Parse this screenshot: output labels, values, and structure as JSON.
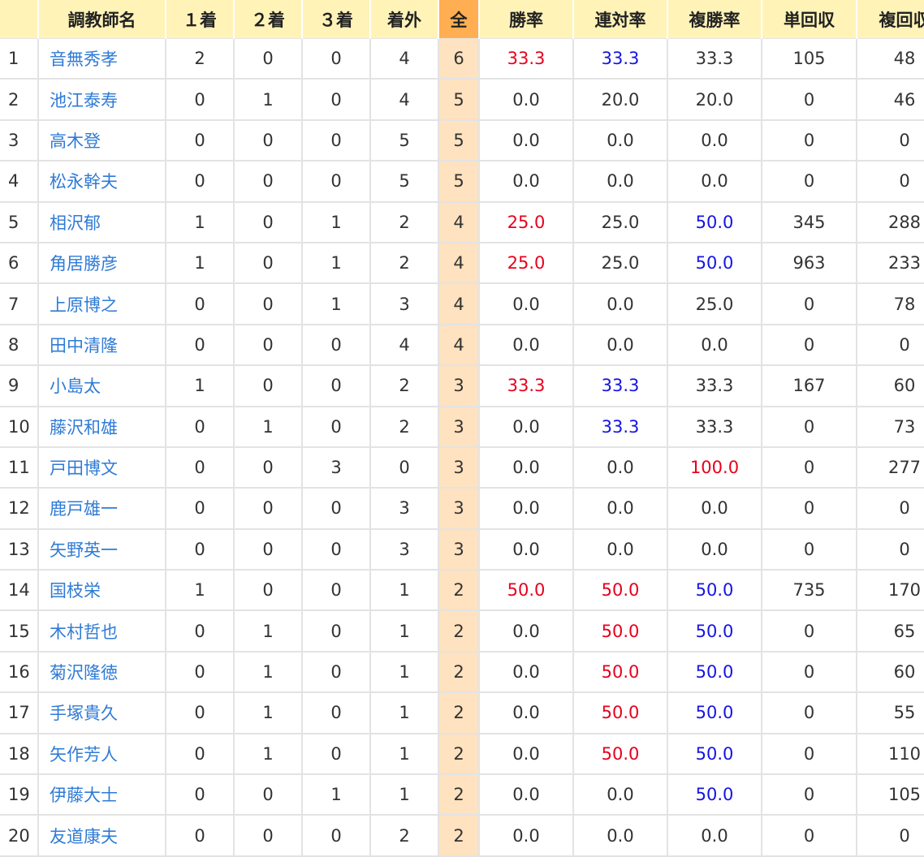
{
  "headers": {
    "rank": "",
    "name": "調教師名",
    "first": "１着",
    "second": "２着",
    "third": "３着",
    "out": "着外",
    "all": "全",
    "win_rate": "勝率",
    "place_rate": "連対率",
    "show_rate": "複勝率",
    "win_return": "単回収",
    "show_return": "複回収"
  },
  "colors": {
    "red": "#e8001c",
    "blue": "#1414e6",
    "link": "#2f7bd6",
    "header_bg": "#fff3b8",
    "all_header_bg": "#ffae52",
    "all_cell_bg": "#ffe2bf"
  },
  "rows": [
    {
      "rank": "1",
      "name": "音無秀孝",
      "first": "2",
      "second": "0",
      "third": "0",
      "out": "4",
      "all": "6",
      "win_rate": "33.3",
      "place_rate": "33.3",
      "show_rate": "33.3",
      "win_return": "105",
      "show_return": "48",
      "win_rate_color": "red",
      "place_rate_color": "blue",
      "show_rate_color": ""
    },
    {
      "rank": "2",
      "name": "池江泰寿",
      "first": "0",
      "second": "1",
      "third": "0",
      "out": "4",
      "all": "5",
      "win_rate": "0.0",
      "place_rate": "20.0",
      "show_rate": "20.0",
      "win_return": "0",
      "show_return": "46",
      "win_rate_color": "",
      "place_rate_color": "",
      "show_rate_color": ""
    },
    {
      "rank": "3",
      "name": "高木登",
      "first": "0",
      "second": "0",
      "third": "0",
      "out": "5",
      "all": "5",
      "win_rate": "0.0",
      "place_rate": "0.0",
      "show_rate": "0.0",
      "win_return": "0",
      "show_return": "0",
      "win_rate_color": "",
      "place_rate_color": "",
      "show_rate_color": ""
    },
    {
      "rank": "4",
      "name": "松永幹夫",
      "first": "0",
      "second": "0",
      "third": "0",
      "out": "5",
      "all": "5",
      "win_rate": "0.0",
      "place_rate": "0.0",
      "show_rate": "0.0",
      "win_return": "0",
      "show_return": "0",
      "win_rate_color": "",
      "place_rate_color": "",
      "show_rate_color": ""
    },
    {
      "rank": "5",
      "name": "相沢郁",
      "first": "1",
      "second": "0",
      "third": "1",
      "out": "2",
      "all": "4",
      "win_rate": "25.0",
      "place_rate": "25.0",
      "show_rate": "50.0",
      "win_return": "345",
      "show_return": "288",
      "win_rate_color": "red",
      "place_rate_color": "",
      "show_rate_color": "blue"
    },
    {
      "rank": "6",
      "name": "角居勝彦",
      "first": "1",
      "second": "0",
      "third": "1",
      "out": "2",
      "all": "4",
      "win_rate": "25.0",
      "place_rate": "25.0",
      "show_rate": "50.0",
      "win_return": "963",
      "show_return": "233",
      "win_rate_color": "red",
      "place_rate_color": "",
      "show_rate_color": "blue"
    },
    {
      "rank": "7",
      "name": "上原博之",
      "first": "0",
      "second": "0",
      "third": "1",
      "out": "3",
      "all": "4",
      "win_rate": "0.0",
      "place_rate": "0.0",
      "show_rate": "25.0",
      "win_return": "0",
      "show_return": "78",
      "win_rate_color": "",
      "place_rate_color": "",
      "show_rate_color": ""
    },
    {
      "rank": "8",
      "name": "田中清隆",
      "first": "0",
      "second": "0",
      "third": "0",
      "out": "4",
      "all": "4",
      "win_rate": "0.0",
      "place_rate": "0.0",
      "show_rate": "0.0",
      "win_return": "0",
      "show_return": "0",
      "win_rate_color": "",
      "place_rate_color": "",
      "show_rate_color": ""
    },
    {
      "rank": "9",
      "name": "小島太",
      "first": "1",
      "second": "0",
      "third": "0",
      "out": "2",
      "all": "3",
      "win_rate": "33.3",
      "place_rate": "33.3",
      "show_rate": "33.3",
      "win_return": "167",
      "show_return": "60",
      "win_rate_color": "red",
      "place_rate_color": "blue",
      "show_rate_color": ""
    },
    {
      "rank": "10",
      "name": "藤沢和雄",
      "first": "0",
      "second": "1",
      "third": "0",
      "out": "2",
      "all": "3",
      "win_rate": "0.0",
      "place_rate": "33.3",
      "show_rate": "33.3",
      "win_return": "0",
      "show_return": "73",
      "win_rate_color": "",
      "place_rate_color": "blue",
      "show_rate_color": ""
    },
    {
      "rank": "11",
      "name": "戸田博文",
      "first": "0",
      "second": "0",
      "third": "3",
      "out": "0",
      "all": "3",
      "win_rate": "0.0",
      "place_rate": "0.0",
      "show_rate": "100.0",
      "win_return": "0",
      "show_return": "277",
      "win_rate_color": "",
      "place_rate_color": "",
      "show_rate_color": "red"
    },
    {
      "rank": "12",
      "name": "鹿戸雄一",
      "first": "0",
      "second": "0",
      "third": "0",
      "out": "3",
      "all": "3",
      "win_rate": "0.0",
      "place_rate": "0.0",
      "show_rate": "0.0",
      "win_return": "0",
      "show_return": "0",
      "win_rate_color": "",
      "place_rate_color": "",
      "show_rate_color": ""
    },
    {
      "rank": "13",
      "name": "矢野英一",
      "first": "0",
      "second": "0",
      "third": "0",
      "out": "3",
      "all": "3",
      "win_rate": "0.0",
      "place_rate": "0.0",
      "show_rate": "0.0",
      "win_return": "0",
      "show_return": "0",
      "win_rate_color": "",
      "place_rate_color": "",
      "show_rate_color": ""
    },
    {
      "rank": "14",
      "name": "国枝栄",
      "first": "1",
      "second": "0",
      "third": "0",
      "out": "1",
      "all": "2",
      "win_rate": "50.0",
      "place_rate": "50.0",
      "show_rate": "50.0",
      "win_return": "735",
      "show_return": "170",
      "win_rate_color": "red",
      "place_rate_color": "red",
      "show_rate_color": "blue"
    },
    {
      "rank": "15",
      "name": "木村哲也",
      "first": "0",
      "second": "1",
      "third": "0",
      "out": "1",
      "all": "2",
      "win_rate": "0.0",
      "place_rate": "50.0",
      "show_rate": "50.0",
      "win_return": "0",
      "show_return": "65",
      "win_rate_color": "",
      "place_rate_color": "red",
      "show_rate_color": "blue"
    },
    {
      "rank": "16",
      "name": "菊沢隆徳",
      "first": "0",
      "second": "1",
      "third": "0",
      "out": "1",
      "all": "2",
      "win_rate": "0.0",
      "place_rate": "50.0",
      "show_rate": "50.0",
      "win_return": "0",
      "show_return": "60",
      "win_rate_color": "",
      "place_rate_color": "red",
      "show_rate_color": "blue"
    },
    {
      "rank": "17",
      "name": "手塚貴久",
      "first": "0",
      "second": "1",
      "third": "0",
      "out": "1",
      "all": "2",
      "win_rate": "0.0",
      "place_rate": "50.0",
      "show_rate": "50.0",
      "win_return": "0",
      "show_return": "55",
      "win_rate_color": "",
      "place_rate_color": "red",
      "show_rate_color": "blue"
    },
    {
      "rank": "18",
      "name": "矢作芳人",
      "first": "0",
      "second": "1",
      "third": "0",
      "out": "1",
      "all": "2",
      "win_rate": "0.0",
      "place_rate": "50.0",
      "show_rate": "50.0",
      "win_return": "0",
      "show_return": "110",
      "win_rate_color": "",
      "place_rate_color": "red",
      "show_rate_color": "blue"
    },
    {
      "rank": "19",
      "name": "伊藤大士",
      "first": "0",
      "second": "0",
      "third": "1",
      "out": "1",
      "all": "2",
      "win_rate": "0.0",
      "place_rate": "0.0",
      "show_rate": "50.0",
      "win_return": "0",
      "show_return": "105",
      "win_rate_color": "",
      "place_rate_color": "",
      "show_rate_color": "blue"
    },
    {
      "rank": "20",
      "name": "友道康夫",
      "first": "0",
      "second": "0",
      "third": "0",
      "out": "2",
      "all": "2",
      "win_rate": "0.0",
      "place_rate": "0.0",
      "show_rate": "0.0",
      "win_return": "0",
      "show_return": "0",
      "win_rate_color": "",
      "place_rate_color": "",
      "show_rate_color": ""
    }
  ]
}
